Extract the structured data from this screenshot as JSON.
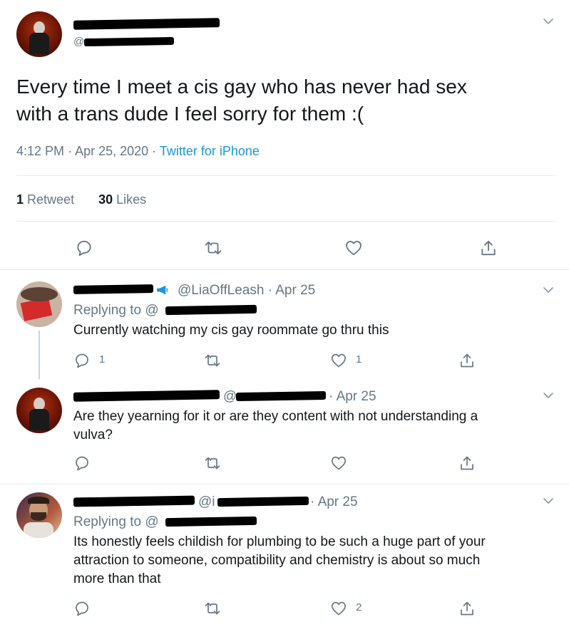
{
  "main_tweet": {
    "handle_prefix": "@",
    "text_line1": "Every time I meet a cis gay who has never had sex",
    "text_line2": "with a trans dude I feel sorry for them :(",
    "time": "4:12 PM",
    "date": "Apr 25, 2020",
    "source": "Twitter for iPhone",
    "retweet_count": "1",
    "retweet_label": "Retweet",
    "like_count": "30",
    "like_label": "Likes"
  },
  "replies": [
    {
      "handle": "@LiaOffLeash",
      "date": "Apr 25",
      "replying_to": "Replying to @",
      "text": "Currently watching my cis gay roommate go thru this",
      "reply_count": "1",
      "like_count": "1"
    },
    {
      "handle_prefix": "@",
      "date": "Apr 25",
      "text_line1": "Are they yearning for it or are they content with not understanding a",
      "text_line2": "vulva?"
    },
    {
      "handle_prefix": "@i",
      "date": "Apr 25",
      "replying_to": "Replying to @",
      "text_line1": "Its honestly feels childish for plumbing to be such a huge part of your",
      "text_line2": "attraction to someone, compatibility and chemistry is about so much",
      "text_line3": "more than that",
      "like_count": "2"
    }
  ],
  "separator": "·",
  "icons": [
    "reply-icon",
    "retweet-icon",
    "like-icon",
    "share-icon",
    "chevron-down-icon",
    "megaphone-icon"
  ],
  "colors": {
    "link": "#1b95e0",
    "muted": "#657786",
    "text": "#14171a",
    "divider": "#e6ecf0"
  }
}
